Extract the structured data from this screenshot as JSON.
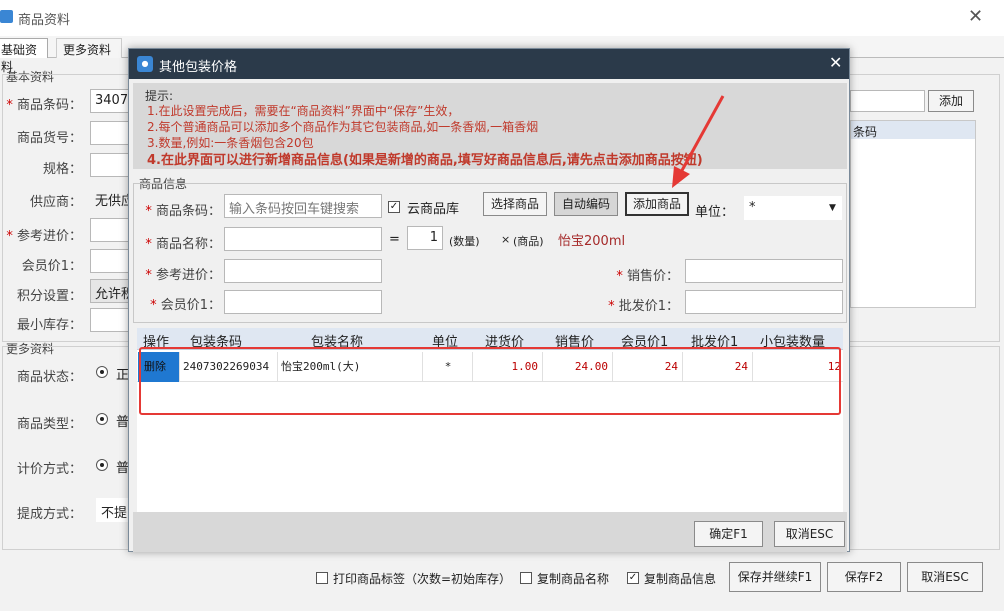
{
  "bg": {
    "title": "商品资料",
    "tab_basic": "基础资料",
    "tab_more": "更多资料",
    "group_basic": "基本资料",
    "group_more": "更多资料",
    "label_barcode": "商品条码：",
    "value_barcode": "3407",
    "label_code": "商品货号：",
    "label_spec": "规格：",
    "label_supplier": "供应商：",
    "value_supplier": "无供应",
    "label_ref_price": "参考进价：",
    "label_member_price1": "会员价1：",
    "label_points": "积分设置：",
    "value_points": "允许积",
    "label_min_stock": "最小库存：",
    "label_status": "商品状态：",
    "value_status": "正",
    "label_type": "商品类型：",
    "value_type": "普",
    "label_pricing": "计价方式：",
    "value_pricing": "普",
    "label_commission": "提成方式：",
    "value_commission": "不提",
    "add_button": "添加",
    "right_col_header": "条码",
    "print_label": "打印商品标签（次数=初始库存）",
    "copy_name": "复制商品名称",
    "copy_info": "复制商品信息",
    "save_continue": "保存并继续F1",
    "save": "保存F2",
    "cancel": "取消ESC"
  },
  "dialog": {
    "title": "其他包装价格",
    "hint_title": "提示:",
    "hints": [
      "1.在此设置完成后，需要在“商品资料”界面中“保存”生效，",
      "2.每个普通商品可以添加多个商品作为其它包装商品,如一条香烟,一箱香烟",
      "3.数量,例如:一条香烟包含20包",
      "4.在此界面可以进行新增商品信息(如果是新增的商品,填写好商品信息后,请先点击添加商品按钮)"
    ],
    "group_info": "商品信息",
    "label_barcode": "商品条码：",
    "barcode_placeholder": "输入条码按回车键搜索",
    "cloud_lib": "云商品库",
    "select_product": "选择商品",
    "auto_code": "自动编码",
    "add_product": "添加商品",
    "label_unit": "单位：",
    "unit_value": "*",
    "label_name": "商品名称：",
    "equals": "=",
    "qty_value": "1",
    "qty_label": "(数量)",
    "times": "×",
    "product_label": "(商品)",
    "product_name": "怡宝200ml",
    "label_ref_price": "参考进价：",
    "label_sale_price": "销售价：",
    "label_member_price1": "会员价1：",
    "label_wholesale1": "批发价1：",
    "grid_headers": [
      "操作",
      "包装条码",
      "包装名称",
      "单位",
      "进货价",
      "销售价",
      "会员价1",
      "批发价1",
      "小包装数量"
    ],
    "rows": [
      {
        "action": "删除",
        "barcode": "2407302269034",
        "name": "怡宝200ml(大)",
        "unit": "*",
        "cost": "1.00",
        "sale": "24.00",
        "member1": "24",
        "wholesale1": "24",
        "small_qty": "12"
      }
    ],
    "ok": "确定F1",
    "cancel": "取消ESC"
  },
  "colors": {
    "annotation": "#e53935",
    "tip_text": "#c0392b",
    "title_bar": "#2b3a4a"
  }
}
